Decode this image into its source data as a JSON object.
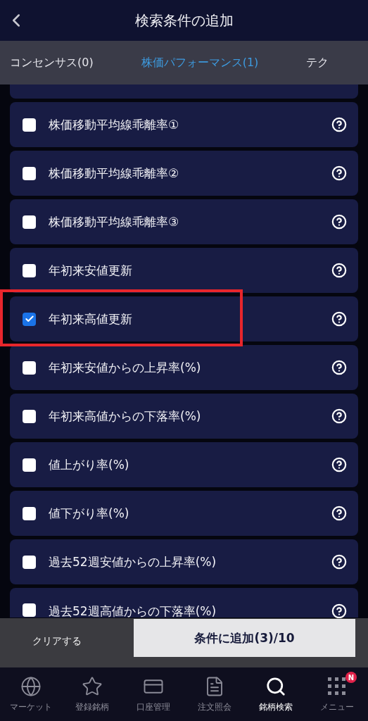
{
  "header": {
    "title": "検索条件の追加"
  },
  "tabs": [
    {
      "label": "コンセンサス(0)",
      "selected": false
    },
    {
      "label": "株価パフォーマンス(1)",
      "selected": true
    },
    {
      "label": "テク",
      "selected": false
    }
  ],
  "conditions": [
    {
      "label": "株価移動平均線乖離率①",
      "checked": false,
      "highlighted": false
    },
    {
      "label": "株価移動平均線乖離率②",
      "checked": false,
      "highlighted": false
    },
    {
      "label": "株価移動平均線乖離率③",
      "checked": false,
      "highlighted": false
    },
    {
      "label": "年初来安値更新",
      "checked": false,
      "highlighted": false
    },
    {
      "label": "年初来高値更新",
      "checked": true,
      "highlighted": true
    },
    {
      "label": "年初来安値からの上昇率(%)",
      "checked": false,
      "highlighted": false
    },
    {
      "label": "年初来高値からの下落率(%)",
      "checked": false,
      "highlighted": false
    },
    {
      "label": "値上がり率(%)",
      "checked": false,
      "highlighted": false
    },
    {
      "label": "値下がり率(%)",
      "checked": false,
      "highlighted": false
    },
    {
      "label": "過去52週安値からの上昇率(%)",
      "checked": false,
      "highlighted": false
    },
    {
      "label": "過去52週高値からの下落率(%)",
      "checked": false,
      "highlighted": false
    }
  ],
  "action_bar": {
    "clear": "クリアする",
    "add": "条件に追加(3)/10"
  },
  "nav": [
    {
      "label": "マーケット",
      "kind": "globe",
      "selected": false
    },
    {
      "label": "登録銘柄",
      "kind": "star",
      "selected": false
    },
    {
      "label": "口座管理",
      "kind": "card",
      "selected": false
    },
    {
      "label": "注文照会",
      "kind": "document",
      "selected": false
    },
    {
      "label": "銘柄検索",
      "kind": "search",
      "selected": true
    },
    {
      "label": "メニュー",
      "kind": "grid",
      "selected": false,
      "badge": "N"
    }
  ]
}
